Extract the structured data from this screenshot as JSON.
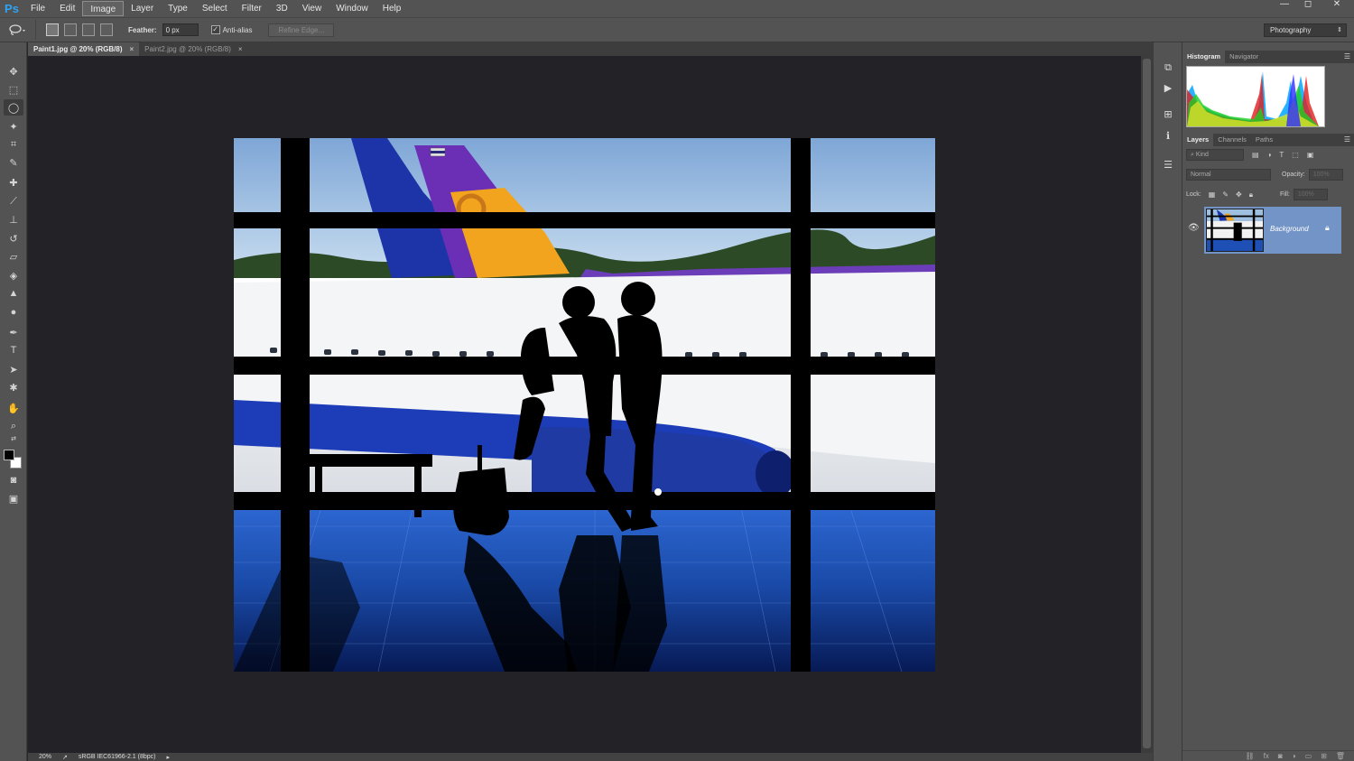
{
  "app": {
    "logo": "Ps"
  },
  "menu": [
    "File",
    "Edit",
    "Image",
    "Layer",
    "Type",
    "Select",
    "Filter",
    "3D",
    "View",
    "Window",
    "Help"
  ],
  "window_controls": {
    "minimize": "—",
    "restore": "◻",
    "close": "✕"
  },
  "options": {
    "feather_label": "Feather:",
    "feather_value": "0 px",
    "antialias_label": "Anti-alias",
    "antialias_checked": true,
    "refine_edge_label": "Refine Edge...",
    "workspace": "Photography"
  },
  "doc_tabs": [
    {
      "label": "Paint1.jpg @ 20% (RGB/8)",
      "active": true
    },
    {
      "label": "Paint2.jpg @ 20% (RGB/8)",
      "active": false
    }
  ],
  "tools": [
    "move-tool-icon",
    "marquee-tool-icon",
    "lasso-tool-icon",
    "magic-wand-icon",
    "crop-tool-icon",
    "eyedropper-icon",
    "healing-brush-icon",
    "brush-tool-icon",
    "clone-stamp-icon",
    "history-brush-icon",
    "eraser-icon",
    "paint-bucket-icon",
    "blur-tool-icon",
    "dodge-tool-icon",
    "pen-tool-icon",
    "type-tool-icon",
    "path-selection-icon",
    "shape-tool-icon",
    "hand-tool-icon",
    "zoom-tool-icon"
  ],
  "colors": {
    "foreground": "#000000",
    "background": "#ffffff",
    "accent": "#7394c7"
  },
  "status": {
    "zoom": "20%",
    "profile": "sRGB IEC61966-2.1 (8bpc)"
  },
  "panels": {
    "histogram_tabs": [
      "Histogram",
      "Navigator"
    ],
    "layers_tabs": [
      "Layers",
      "Channels",
      "Paths"
    ],
    "kind_filter": "Kind",
    "blend_mode": "Normal",
    "opacity_label": "Opacity:",
    "opacity_value": "100%",
    "lock_label": "Lock:",
    "fill_label": "Fill:",
    "fill_value": "100%",
    "layers": [
      {
        "name": "Background",
        "visible": true,
        "locked": true
      }
    ]
  }
}
